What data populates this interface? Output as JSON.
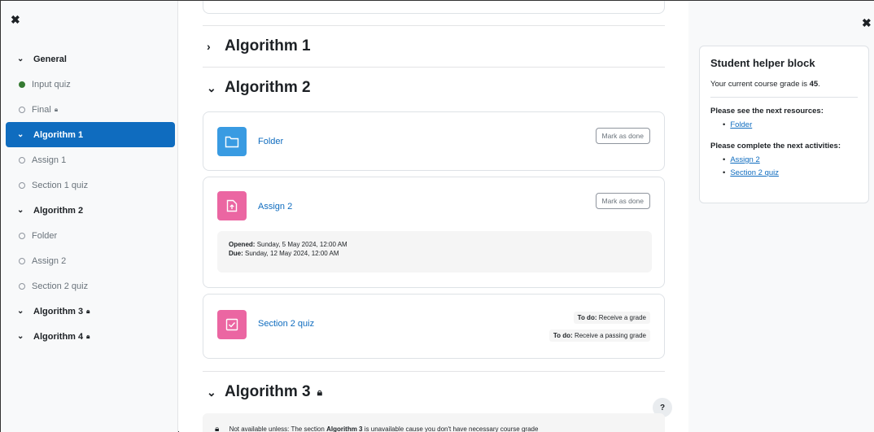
{
  "left_drawer": {
    "close_label": "✖",
    "items": [
      {
        "kind": "section",
        "label": "General",
        "locked": false
      },
      {
        "kind": "activity",
        "label": "Input quiz",
        "done": true
      },
      {
        "kind": "activity",
        "label": "Final",
        "locked": true
      },
      {
        "kind": "section",
        "label": "Algorithm 1",
        "active": true
      },
      {
        "kind": "activity",
        "label": "Assign 1"
      },
      {
        "kind": "activity",
        "label": "Section 1 quiz"
      },
      {
        "kind": "section",
        "label": "Algorithm 2"
      },
      {
        "kind": "activity",
        "label": "Folder"
      },
      {
        "kind": "activity",
        "label": "Assign 2"
      },
      {
        "kind": "activity",
        "label": "Section 2 quiz"
      },
      {
        "kind": "section",
        "label": "Algorithm 3",
        "locked": true
      },
      {
        "kind": "section",
        "label": "Algorithm 4",
        "locked": true
      }
    ]
  },
  "main": {
    "sections": {
      "alg1": {
        "title": "Algorithm 1",
        "toggle": "›"
      },
      "alg2": {
        "title": "Algorithm 2",
        "toggle": "⌄"
      },
      "alg3": {
        "title": "Algorithm 3",
        "toggle": "⌄"
      }
    },
    "folder": {
      "name": "Folder",
      "mark_label": "Mark as done"
    },
    "assign2": {
      "name": "Assign 2",
      "mark_label": "Mark as done",
      "opened_label": "Opened:",
      "opened_value": "Sunday, 5 May 2024, 12:00 AM",
      "due_label": "Due:",
      "due_value": "Sunday, 12 May 2024, 12:00 AM"
    },
    "quiz2": {
      "name": "Section 2 quiz",
      "todo_label": "To do:",
      "todo1": "Receive a grade",
      "todo2": "Receive a passing grade"
    },
    "restriction": {
      "prefix": "Not available unless: The section",
      "section": "Algorithm 3",
      "suffix": "is unavailable cause you don't have necessary course grade"
    },
    "help_label": "?"
  },
  "right_drawer": {
    "close_label": "✖",
    "block": {
      "title": "Student helper block",
      "grade_prefix": "Your current course grade is",
      "grade_value": "45",
      "grade_suffix": ".",
      "resources_heading": "Please see the next resources:",
      "resources": [
        "Folder"
      ],
      "activities_heading": "Please complete the next activities:",
      "activities": [
        "Assign 2",
        "Section 2 quiz"
      ]
    }
  },
  "colors": {
    "primary": "#0f6cbf",
    "folder_icon": "#399be2",
    "assign_icon": "#eb66a2",
    "done": "#357a32"
  }
}
